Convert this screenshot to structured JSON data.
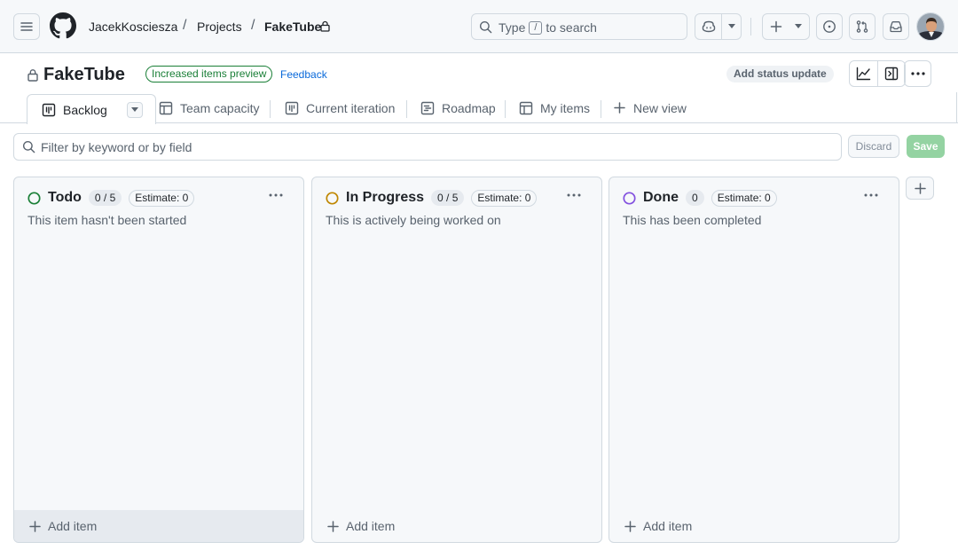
{
  "header": {
    "breadcrumb": {
      "owner": "JacekKosciesza",
      "projects": "Projects",
      "project": "FakeTube",
      "separator": "/"
    },
    "search": {
      "prefix": "Type",
      "shortcut": "/",
      "suffix": "to search"
    },
    "icons": [
      "hamburger-icon",
      "github-logo",
      "search-icon",
      "copilot-icon",
      "plus-icon",
      "issue-icon",
      "pull-request-icon",
      "inbox-icon"
    ]
  },
  "project": {
    "title": "FakeTube",
    "preview_label": "Increased items preview",
    "feedback_label": "Feedback",
    "status_update_label": "Add status update"
  },
  "views": [
    {
      "label": "Backlog",
      "icon": "board-icon",
      "active": true
    },
    {
      "label": "Team capacity",
      "icon": "table-icon"
    },
    {
      "label": "Current iteration",
      "icon": "board-icon"
    },
    {
      "label": "Roadmap",
      "icon": "roadmap-icon"
    },
    {
      "label": "My items",
      "icon": "table-icon"
    },
    {
      "label": "New view",
      "icon": "plus-icon"
    }
  ],
  "filter": {
    "placeholder": "Filter by keyword or by field",
    "discard_label": "Discard",
    "save_label": "Save"
  },
  "columns": [
    {
      "name": "Todo",
      "count": "0 / 5",
      "estimate": "Estimate: 0",
      "description": "This item hasn't been started",
      "status_color": "#1a7f37",
      "add_label": "Add item"
    },
    {
      "name": "In Progress",
      "count": "0 / 5",
      "estimate": "Estimate: 0",
      "description": "This is actively being worked on",
      "status_color": "#bf8700",
      "add_label": "Add item"
    },
    {
      "name": "Done",
      "count": "0",
      "estimate": "Estimate: 0",
      "description": "This has been completed",
      "status_color": "#8250df",
      "add_label": "Add item"
    }
  ]
}
